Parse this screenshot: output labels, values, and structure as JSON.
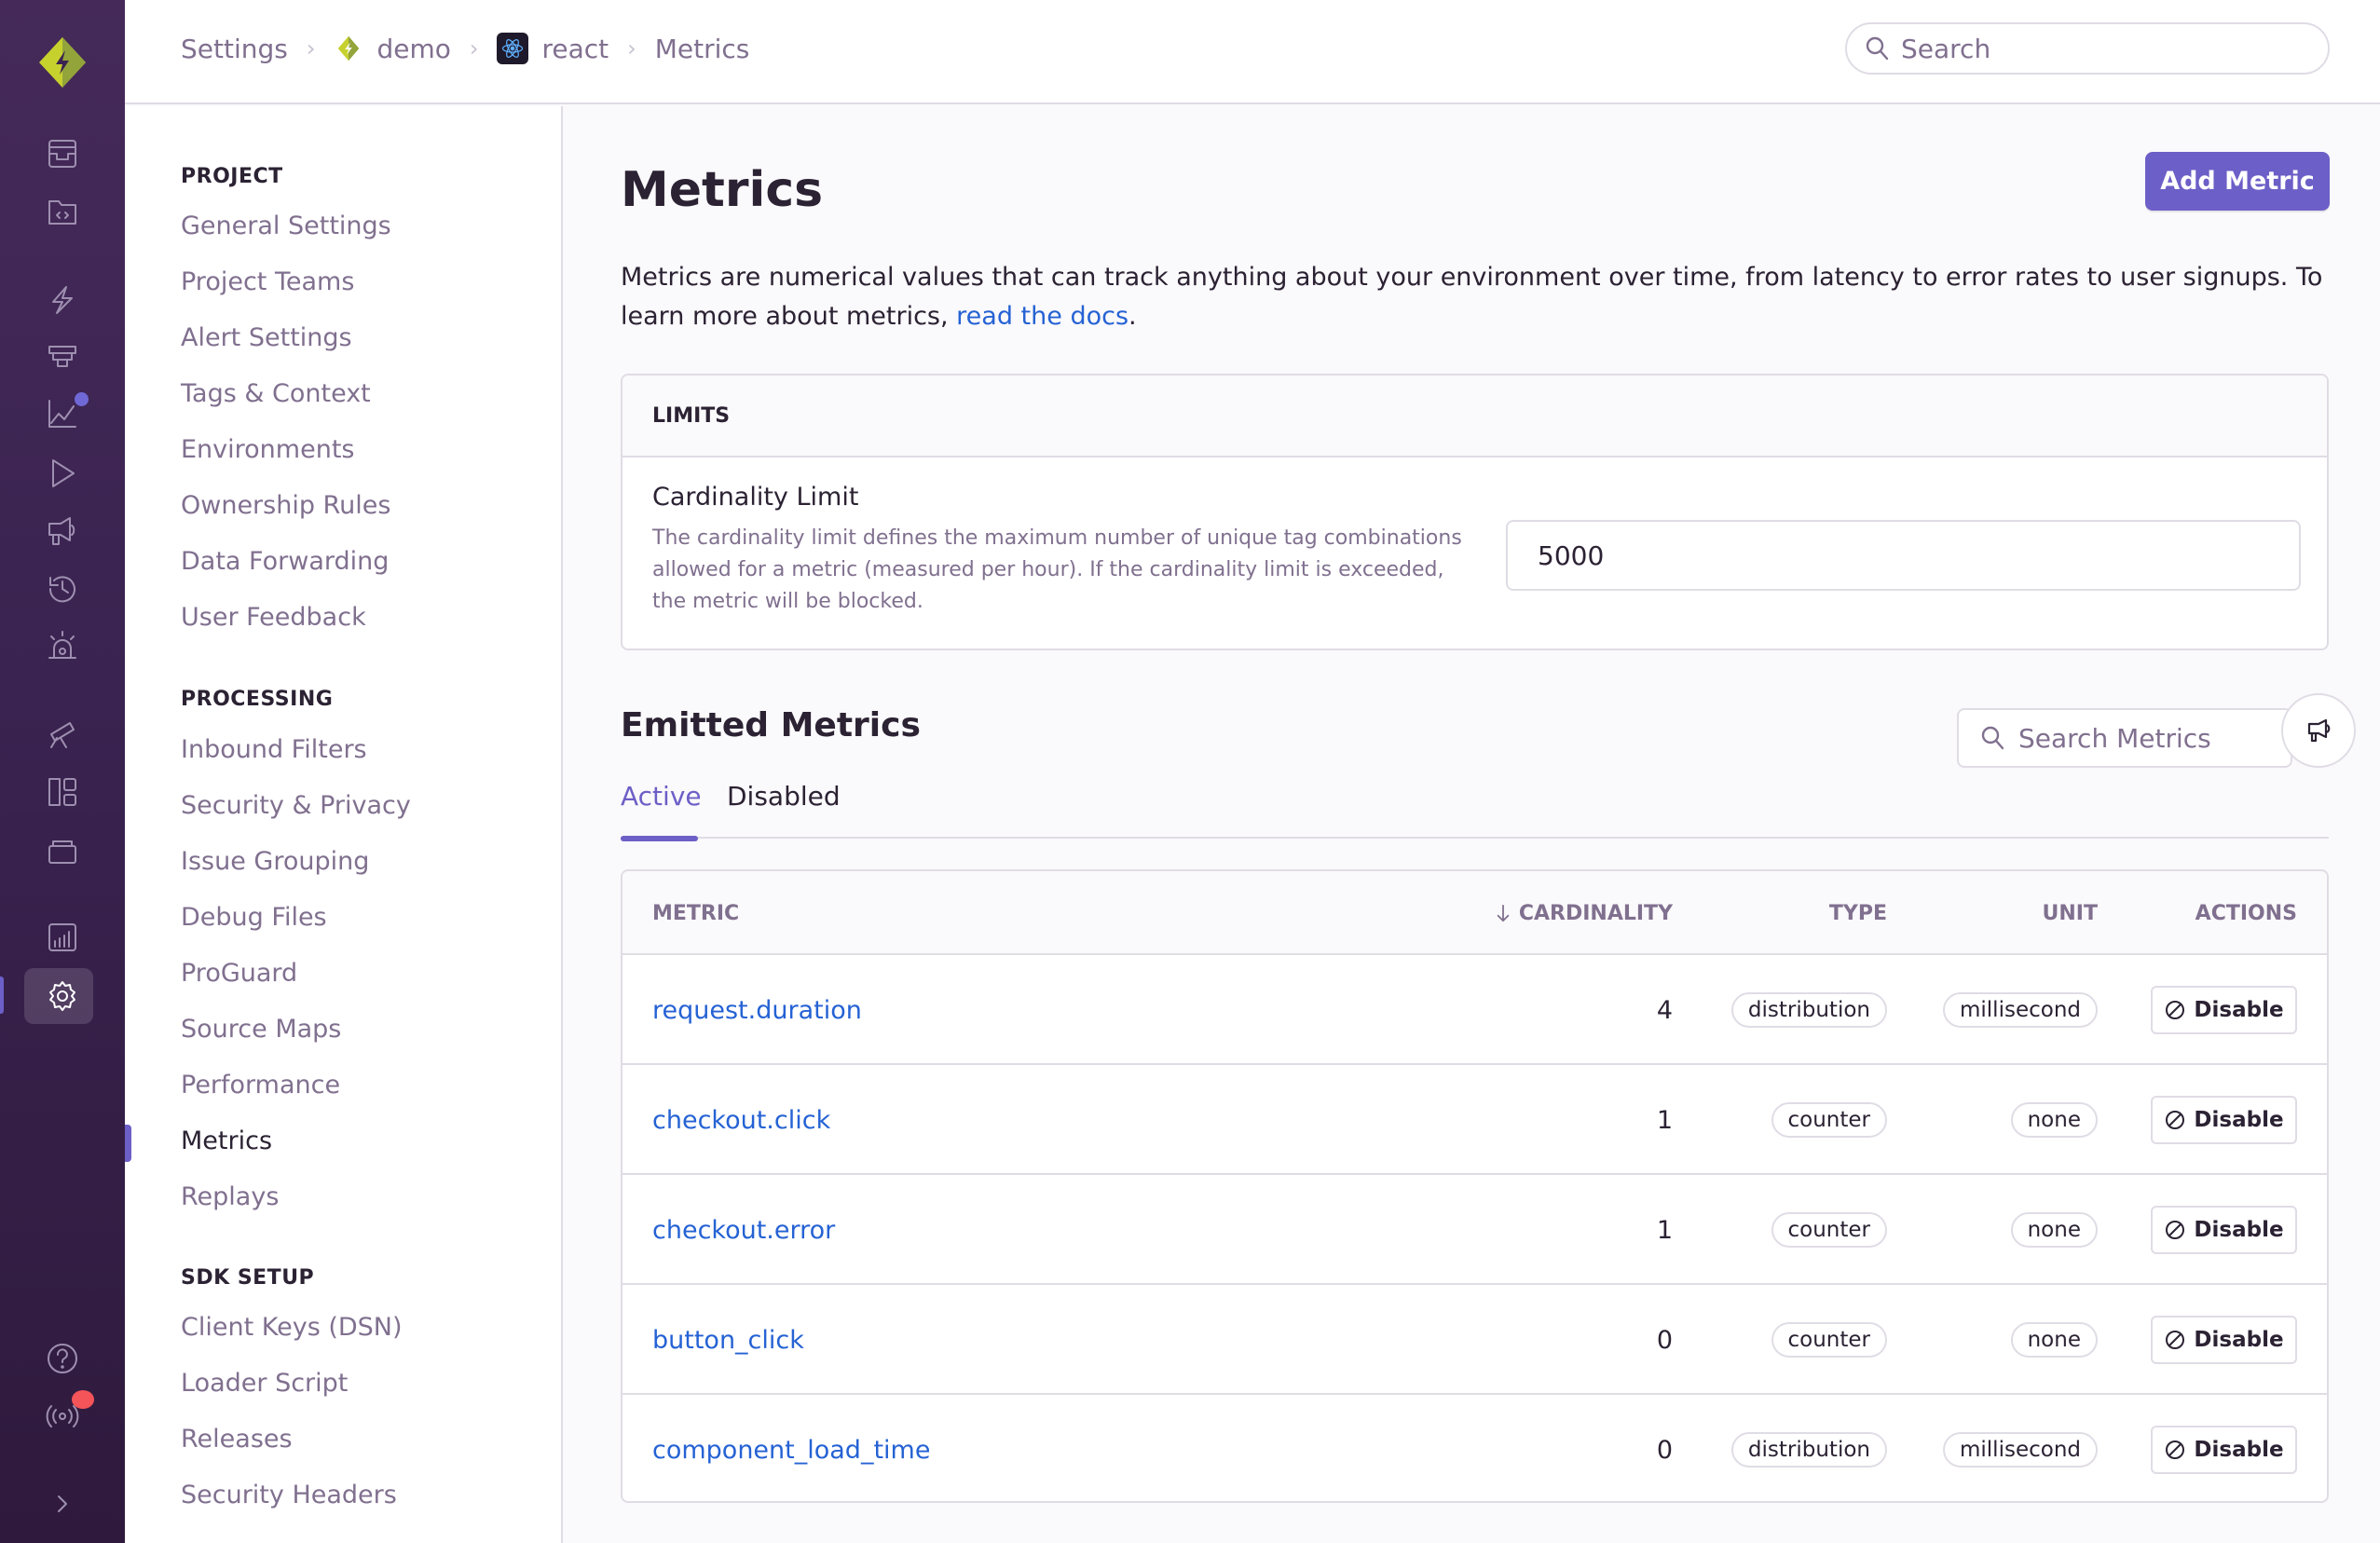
{
  "colors": {
    "accent": "#6c5fc7",
    "link": "#2562d4",
    "sidebar": "#3a2350",
    "text": "#2b2233",
    "muted": "#80708f",
    "border": "#e0dce5",
    "badge_red": "#f55459"
  },
  "breadcrumb": [
    {
      "label": "Settings"
    },
    {
      "label": "demo",
      "icon": "sentry-project-icon"
    },
    {
      "label": "react",
      "icon": "react-icon"
    },
    {
      "label": "Metrics"
    }
  ],
  "header_search": {
    "placeholder": "Search"
  },
  "primary_nav": {
    "icons": [
      "issues-icon",
      "projects-icon",
      "performance-icon",
      "profiling-icon",
      "metrics-icon",
      "replays-icon",
      "user-feedback-icon",
      "crons-icon",
      "alerts-icon",
      "discover-icon",
      "dashboards-icon",
      "releases-icon",
      "stats-icon",
      "settings-icon",
      "help-icon",
      "broadcasts-icon",
      "collapse-icon"
    ],
    "active": "settings-icon"
  },
  "settings_nav": {
    "sections": [
      {
        "heading": "PROJECT",
        "items": [
          "General Settings",
          "Project Teams",
          "Alert Settings",
          "Tags & Context",
          "Environments",
          "Ownership Rules",
          "Data Forwarding",
          "User Feedback"
        ]
      },
      {
        "heading": "PROCESSING",
        "items": [
          "Inbound Filters",
          "Security & Privacy",
          "Issue Grouping",
          "Debug Files",
          "ProGuard",
          "Source Maps",
          "Performance",
          "Metrics",
          "Replays"
        ]
      },
      {
        "heading": "SDK SETUP",
        "items": [
          "Client Keys (DSN)",
          "Loader Script",
          "Releases",
          "Security Headers"
        ]
      }
    ],
    "active_item": "Metrics"
  },
  "page": {
    "title": "Metrics",
    "add_button": "Add Metric",
    "description_pre": "Metrics are numerical values that can track anything about your environment over time, from latency to error rates to user signups. To learn more about metrics, ",
    "description_link": "read the docs",
    "description_post": "."
  },
  "limits": {
    "heading": "LIMITS",
    "field_label": "Cardinality Limit",
    "field_help": "The cardinality limit defines the maximum number of unique tag combinations allowed for a metric (measured per hour). If the cardinality limit is exceeded, the metric will be blocked.",
    "field_value": "5000"
  },
  "emitted": {
    "title": "Emitted Metrics",
    "search_placeholder": "Search Metrics",
    "tabs": [
      {
        "label": "Active",
        "active": true
      },
      {
        "label": "Disabled",
        "active": false
      }
    ],
    "columns": {
      "metric": "METRIC",
      "cardinality": "CARDINALITY",
      "type": "TYPE",
      "unit": "UNIT",
      "actions": "ACTIONS"
    },
    "sort": {
      "column": "cardinality",
      "direction": "desc"
    },
    "rows": [
      {
        "metric": "request.duration",
        "cardinality": "4",
        "type": "distribution",
        "unit": "millisecond",
        "action": "Disable"
      },
      {
        "metric": "checkout.click",
        "cardinality": "1",
        "type": "counter",
        "unit": "none",
        "action": "Disable"
      },
      {
        "metric": "checkout.error",
        "cardinality": "1",
        "type": "counter",
        "unit": "none",
        "action": "Disable"
      },
      {
        "metric": "button_click",
        "cardinality": "0",
        "type": "counter",
        "unit": "none",
        "action": "Disable"
      },
      {
        "metric": "component_load_time",
        "cardinality": "0",
        "type": "distribution",
        "unit": "millisecond",
        "action": "Disable"
      }
    ]
  }
}
